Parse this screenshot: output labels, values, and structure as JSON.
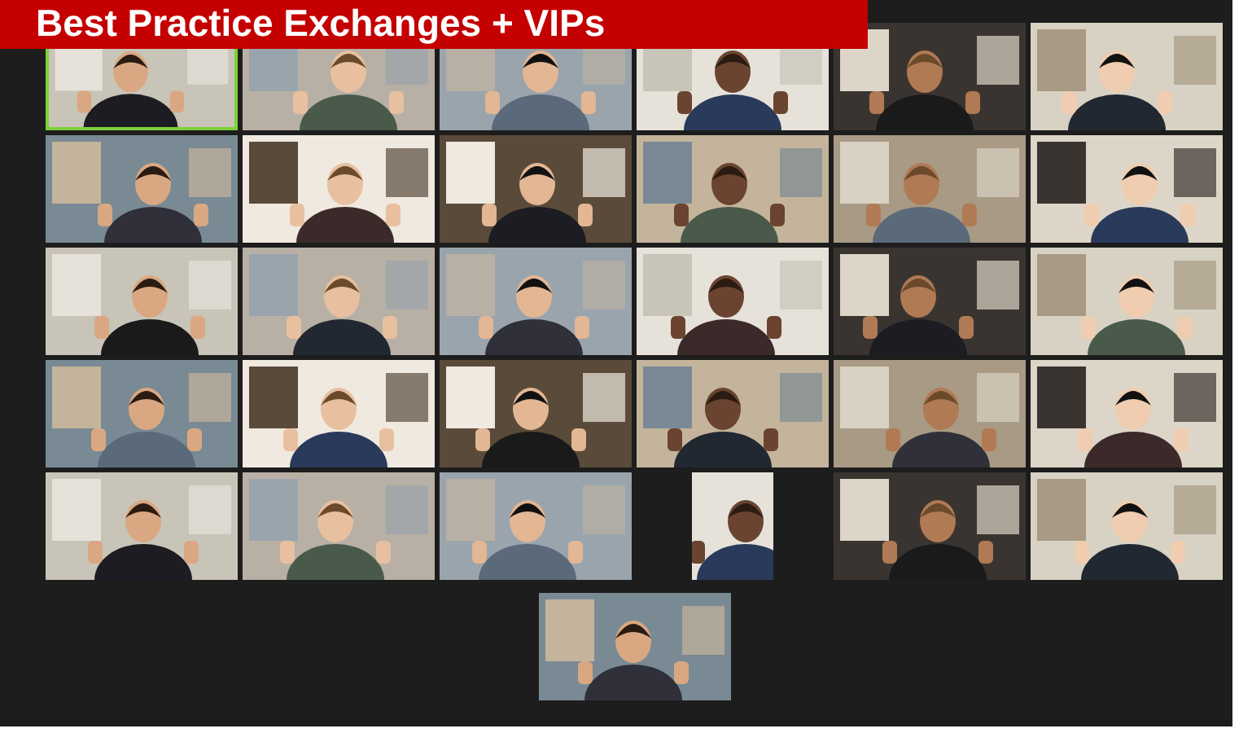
{
  "banner": {
    "title": "Best Practice Exchanges + VIPs"
  },
  "gallery": {
    "rows": [
      [
        {
          "kind": "picture",
          "speaking": true
        },
        {
          "kind": "picture",
          "speaking": false
        },
        {
          "kind": "picture",
          "speaking": false
        },
        {
          "kind": "picture",
          "speaking": false
        },
        {
          "kind": "picture",
          "speaking": false
        },
        {
          "kind": "picture",
          "speaking": false
        }
      ],
      [
        {
          "kind": "picture",
          "speaking": false
        },
        {
          "kind": "picture",
          "speaking": false
        },
        {
          "kind": "picture",
          "speaking": false
        },
        {
          "kind": "picture",
          "speaking": false
        },
        {
          "kind": "picture",
          "speaking": false
        },
        {
          "kind": "picture",
          "speaking": false
        }
      ],
      [
        {
          "kind": "picture",
          "speaking": false
        },
        {
          "kind": "picture",
          "speaking": false
        },
        {
          "kind": "picture",
          "speaking": false
        },
        {
          "kind": "picture",
          "speaking": false
        },
        {
          "kind": "picture",
          "speaking": false
        },
        {
          "kind": "picture",
          "speaking": false
        }
      ],
      [
        {
          "kind": "picture",
          "speaking": false
        },
        {
          "kind": "picture",
          "speaking": false
        },
        {
          "kind": "picture",
          "speaking": false
        },
        {
          "kind": "picture",
          "speaking": false
        },
        {
          "kind": "picture",
          "speaking": false
        },
        {
          "kind": "picture",
          "speaking": false
        }
      ],
      [
        {
          "kind": "picture",
          "speaking": false
        },
        {
          "kind": "picture",
          "speaking": false
        },
        {
          "kind": "picture",
          "speaking": false
        },
        {
          "kind": "portrait",
          "speaking": false
        },
        {
          "kind": "picture",
          "speaking": false
        },
        {
          "kind": "picture",
          "speaking": false
        }
      ],
      [
        {
          "kind": "picture",
          "speaking": false
        }
      ]
    ]
  }
}
